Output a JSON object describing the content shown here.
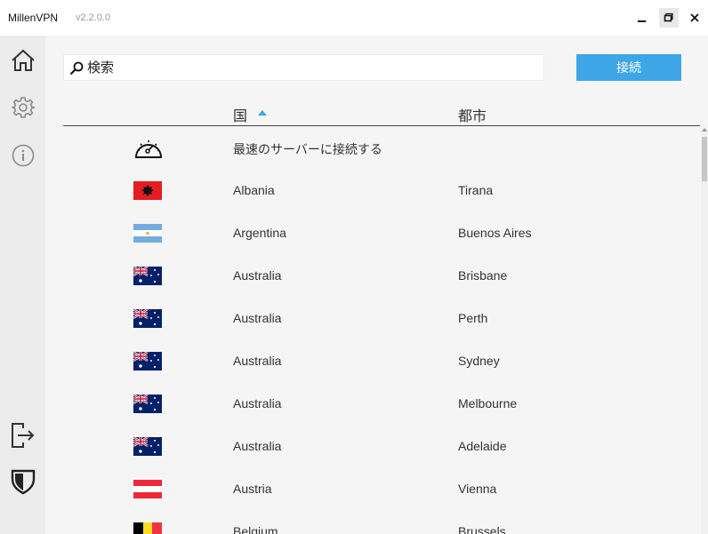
{
  "window": {
    "app_name": "MillenVPN",
    "version": "v2.2.0.0"
  },
  "sidebar": {
    "items": [
      {
        "icon": "home-icon"
      },
      {
        "icon": "gear-icon"
      },
      {
        "icon": "info-icon"
      },
      {
        "icon": "logout-icon"
      },
      {
        "icon": "shield-icon"
      }
    ]
  },
  "search": {
    "placeholder": "検索",
    "value": ""
  },
  "connect_button": "接続",
  "table": {
    "headers": {
      "country": "国",
      "city": "都市"
    },
    "fastest_label": "最速のサーバーに接続する",
    "rows": [
      {
        "country": "Albania",
        "city": "Tirana",
        "flag": "albania"
      },
      {
        "country": "Argentina",
        "city": "Buenos Aires",
        "flag": "argentina"
      },
      {
        "country": "Australia",
        "city": "Brisbane",
        "flag": "australia"
      },
      {
        "country": "Australia",
        "city": "Perth",
        "flag": "australia"
      },
      {
        "country": "Australia",
        "city": "Sydney",
        "flag": "australia"
      },
      {
        "country": "Australia",
        "city": "Melbourne",
        "flag": "australia"
      },
      {
        "country": "Australia",
        "city": "Adelaide",
        "flag": "australia"
      },
      {
        "country": "Austria",
        "city": "Vienna",
        "flag": "austria"
      },
      {
        "country": "Belgium",
        "city": "Brussels",
        "flag": "belgium"
      }
    ]
  },
  "colors": {
    "accent": "#3ea6e6",
    "sidebar_bg": "#ececec",
    "main_bg": "#f5f5f5"
  }
}
